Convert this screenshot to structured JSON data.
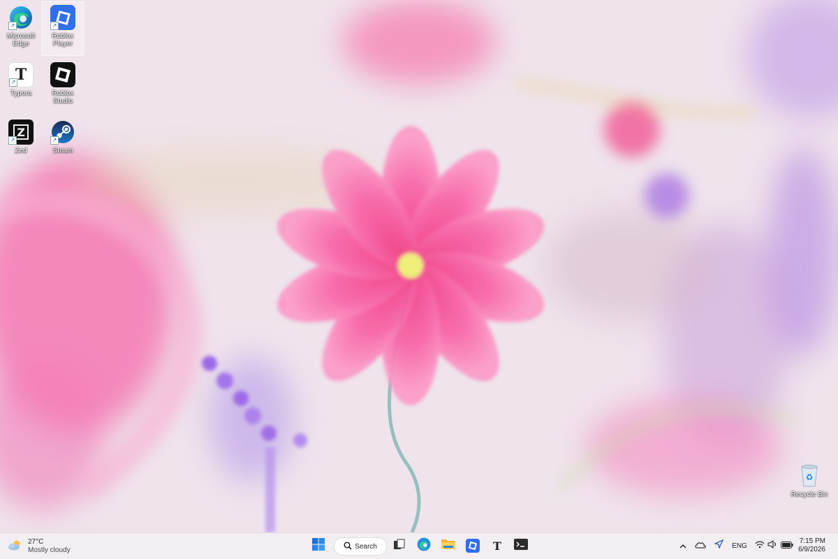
{
  "desktop": {
    "icons": [
      {
        "label": "Microsoft Edge",
        "icon": "edge-icon",
        "selected": false
      },
      {
        "label": "Roblox Player",
        "icon": "roblox-player-icon",
        "selected": true
      },
      {
        "label": "Typora",
        "icon": "typora-icon",
        "selected": false
      },
      {
        "label": "Roblox Studio",
        "icon": "roblox-studio-icon",
        "selected": false
      },
      {
        "label": "Zed",
        "icon": "zed-icon",
        "selected": false
      },
      {
        "label": "Steam",
        "icon": "steam-icon",
        "selected": false
      }
    ],
    "recycle_bin": {
      "label": "Recycle Bin",
      "icon": "recycle-bin-icon"
    }
  },
  "taskbar": {
    "weather": {
      "temp": "27°C",
      "condition": "Mostly cloudy",
      "icon": "cloudy-weather-icon"
    },
    "search_label": "Search",
    "apps": [
      {
        "name": "start-button",
        "icon": "windows-start-icon"
      },
      {
        "name": "task-view-button",
        "icon": "task-view-icon"
      },
      {
        "name": "taskbar-edge-button",
        "icon": "edge-icon"
      },
      {
        "name": "taskbar-file-explorer-button",
        "icon": "folder-icon"
      },
      {
        "name": "taskbar-roblox-button",
        "icon": "roblox-icon"
      },
      {
        "name": "taskbar-typora-button",
        "icon": "typora-icon"
      },
      {
        "name": "taskbar-terminal-button",
        "icon": "terminal-icon"
      }
    ],
    "tray": {
      "language": "ENG",
      "icons": [
        "chevron-up-icon",
        "onedrive-icon",
        "location-icon",
        "wifi-icon",
        "volume-icon",
        "battery-icon"
      ]
    },
    "clock": {
      "time": "7:15 PM",
      "date": "6/9/2026"
    }
  },
  "colors": {
    "flower_pink": "#f4609a",
    "flower_center": "#eef07a",
    "lavender": "#a86ee8",
    "taskbar_bg": "#f3eef2",
    "accent_blue": "#1a6fdb"
  }
}
